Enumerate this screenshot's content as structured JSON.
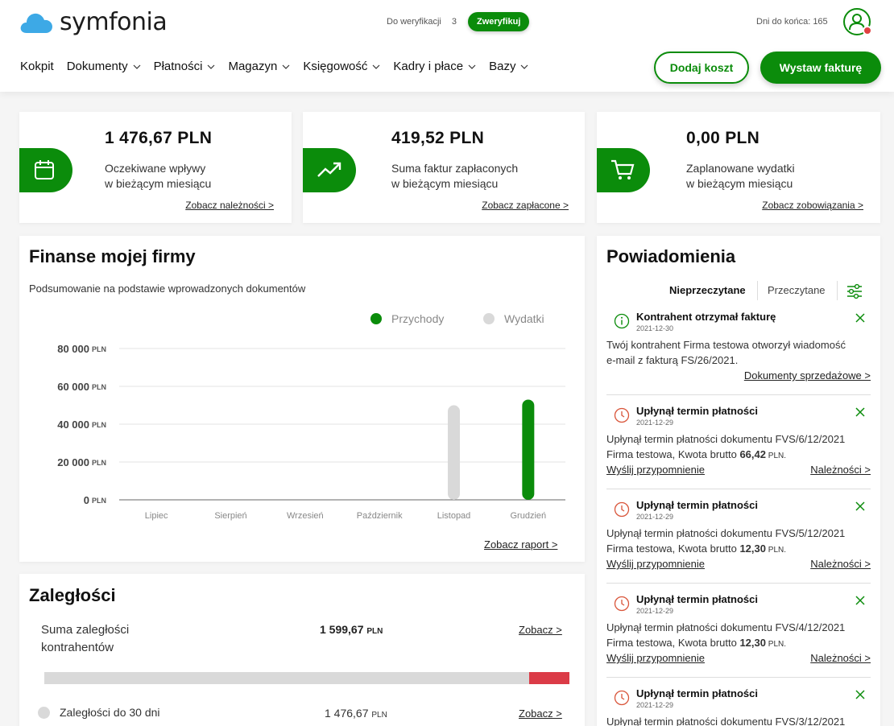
{
  "header": {
    "logo_text": "symfonia",
    "verify_label": "Do weryfikacji",
    "verify_count": "3",
    "verify_button": "Zweryfikuj",
    "days_left": "Dni do końca: 165",
    "nav": [
      {
        "label": "Kokpit",
        "has_menu": false
      },
      {
        "label": "Dokumenty",
        "has_menu": true
      },
      {
        "label": "Płatności",
        "has_menu": true
      },
      {
        "label": "Magazyn",
        "has_menu": true
      },
      {
        "label": "Księgowość",
        "has_menu": true
      },
      {
        "label": "Kadry i płace",
        "has_menu": true
      },
      {
        "label": "Bazy",
        "has_menu": true
      }
    ],
    "add_cost": "Dodaj koszt",
    "issue_invoice": "Wystaw fakturę"
  },
  "stats": [
    {
      "amount": "1 476,67 PLN",
      "line1": "Oczekiwane wpływy",
      "line2": "w bieżącym miesiącu",
      "link": "Zobacz należności >",
      "icon": "calendar-icon"
    },
    {
      "amount": "419,52 PLN",
      "line1": "Suma faktur zapłaconych",
      "line2": "w bieżącym miesiącu",
      "link": "Zobacz zapłacone >",
      "icon": "trend-up-icon"
    },
    {
      "amount": "0,00 PLN",
      "line1": "Zaplanowane wydatki",
      "line2": "w bieżącym miesiącu",
      "link": "Zobacz zobowiązania >",
      "icon": "cart-icon"
    }
  ],
  "finance": {
    "title": "Finanse mojej firmy",
    "subtitle": "Podsumowanie na podstawie wprowadzonych dokumentów",
    "report_link": "Zobacz raport >"
  },
  "chart_data": {
    "type": "bar",
    "categories": [
      "Lipiec",
      "Sierpień",
      "Wrzesień",
      "Październik",
      "Listopad",
      "Grudzień"
    ],
    "series": [
      {
        "name": "Przychody",
        "color": "#0b8c0b",
        "values": [
          0,
          0,
          0,
          0,
          0,
          53000
        ]
      },
      {
        "name": "Wydatki",
        "color": "#d9d9d9",
        "values": [
          0,
          0,
          0,
          0,
          50000,
          0
        ]
      }
    ],
    "ylim": [
      0,
      80000
    ],
    "yticks": [
      {
        "value": 80000,
        "label": "80 000",
        "unit": "PLN"
      },
      {
        "value": 60000,
        "label": "60 000",
        "unit": "PLN"
      },
      {
        "value": 40000,
        "label": "40 000",
        "unit": "PLN"
      },
      {
        "value": 20000,
        "label": "20 000",
        "unit": "PLN"
      },
      {
        "value": 0,
        "label": "0",
        "unit": "PLN"
      }
    ],
    "grid": true,
    "legend_position": "top-right"
  },
  "overdue": {
    "title": "Zaległości",
    "sum_label_1": "Suma zaległości",
    "sum_label_2": "kontrahentów",
    "sum_value": "1 599,67",
    "sum_unit": "PLN",
    "sum_link": "Zobacz >",
    "red_fraction": 0.077,
    "row_label": "Zaległości do 30 dni",
    "row_value": "1 476,67",
    "row_unit": "PLN",
    "row_link": "Zobacz >"
  },
  "notifications": {
    "title": "Powiadomienia",
    "tab_unread": "Nieprzeczytane",
    "tab_read": "Przeczytane",
    "items": [
      {
        "type": "info",
        "title": "Kontrahent otrzymał fakturę",
        "date": "2021-12-30",
        "line1": "Twój kontrahent Firma testowa otworzył wiadomość",
        "line2": "e-mail z fakturą FS/26/2021.",
        "right_link": "Dokumenty sprzedażowe >"
      },
      {
        "type": "clock",
        "title": "Upłynął termin płatności",
        "date": "2021-12-29",
        "line1": "Upłynął termin płatności dokumentu FVS/6/12/2021",
        "line2_pre": "Firma testowa, Kwota brutto ",
        "amount": "66,42",
        "unit": " PLN.",
        "left_link": "Wyślij przypomnienie",
        "right_link": "Należności >"
      },
      {
        "type": "clock",
        "title": "Upłynął termin płatności",
        "date": "2021-12-29",
        "line1": "Upłynął termin płatności dokumentu FVS/5/12/2021",
        "line2_pre": "Firma testowa, Kwota brutto ",
        "amount": "12,30",
        "unit": " PLN.",
        "left_link": "Wyślij przypomnienie",
        "right_link": "Należności >"
      },
      {
        "type": "clock",
        "title": "Upłynął termin płatności",
        "date": "2021-12-29",
        "line1": "Upłynął termin płatności dokumentu FVS/4/12/2021",
        "line2_pre": "Firma testowa, Kwota brutto ",
        "amount": "12,30",
        "unit": " PLN.",
        "left_link": "Wyślij przypomnienie",
        "right_link": "Należności >"
      },
      {
        "type": "clock",
        "title": "Upłynął termin płatności",
        "date": "2021-12-29",
        "line1": "Upłynął termin płatności dokumentu FVS/3/12/2021"
      }
    ]
  },
  "colors": {
    "brand_green": "#0b8c0b",
    "alert_red": "#db3b47",
    "clock_red": "#d9553a",
    "expense_gray": "#d9d9d9"
  }
}
